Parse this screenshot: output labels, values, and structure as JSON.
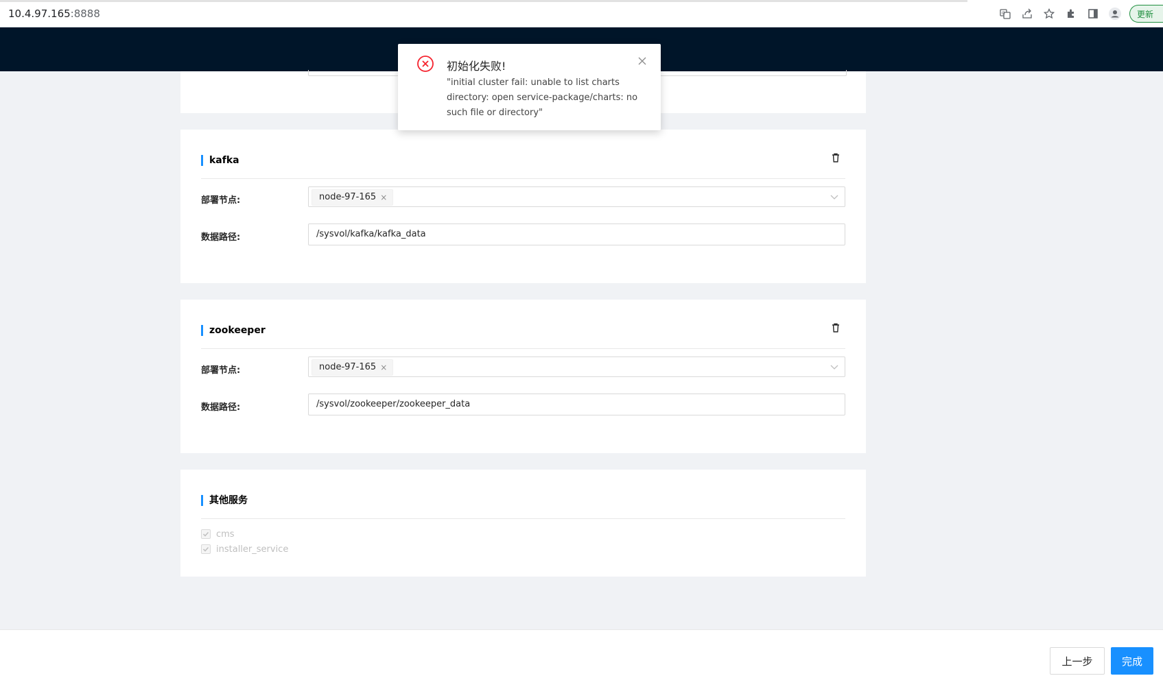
{
  "browser": {
    "url_host": "10.4.97.165",
    "url_port": ":8888",
    "update_label": "更新"
  },
  "sections": {
    "kafka": {
      "title": "kafka",
      "node_label": "部署节点:",
      "node_tag": "node-97-165",
      "path_label": "数据路径:",
      "path_value": "/sysvol/kafka/kafka_data"
    },
    "zookeeper": {
      "title": "zookeeper",
      "node_label": "部署节点:",
      "node_tag": "node-97-165",
      "path_label": "数据路径:",
      "path_value": "/sysvol/zookeeper/zookeeper_data"
    },
    "other": {
      "title": "其他服务",
      "items": [
        "cms",
        "installer_service"
      ]
    }
  },
  "footer": {
    "prev_label": "上一步",
    "done_label": "完成"
  },
  "notification": {
    "title": "初始化失败!",
    "message": "\"initial cluster fail: unable to list charts directory: open service-package/charts: no such file or directory\""
  },
  "colors": {
    "header_bg": "#001529",
    "accent": "#1890ff",
    "error": "#f5222d"
  },
  "icons": [
    "translate-icon",
    "share-icon",
    "star-icon",
    "extensions-icon",
    "sidepanel-icon",
    "profile-icon",
    "delete-icon",
    "chevron-down-icon",
    "error-circle-icon",
    "close-icon",
    "check-icon"
  ]
}
